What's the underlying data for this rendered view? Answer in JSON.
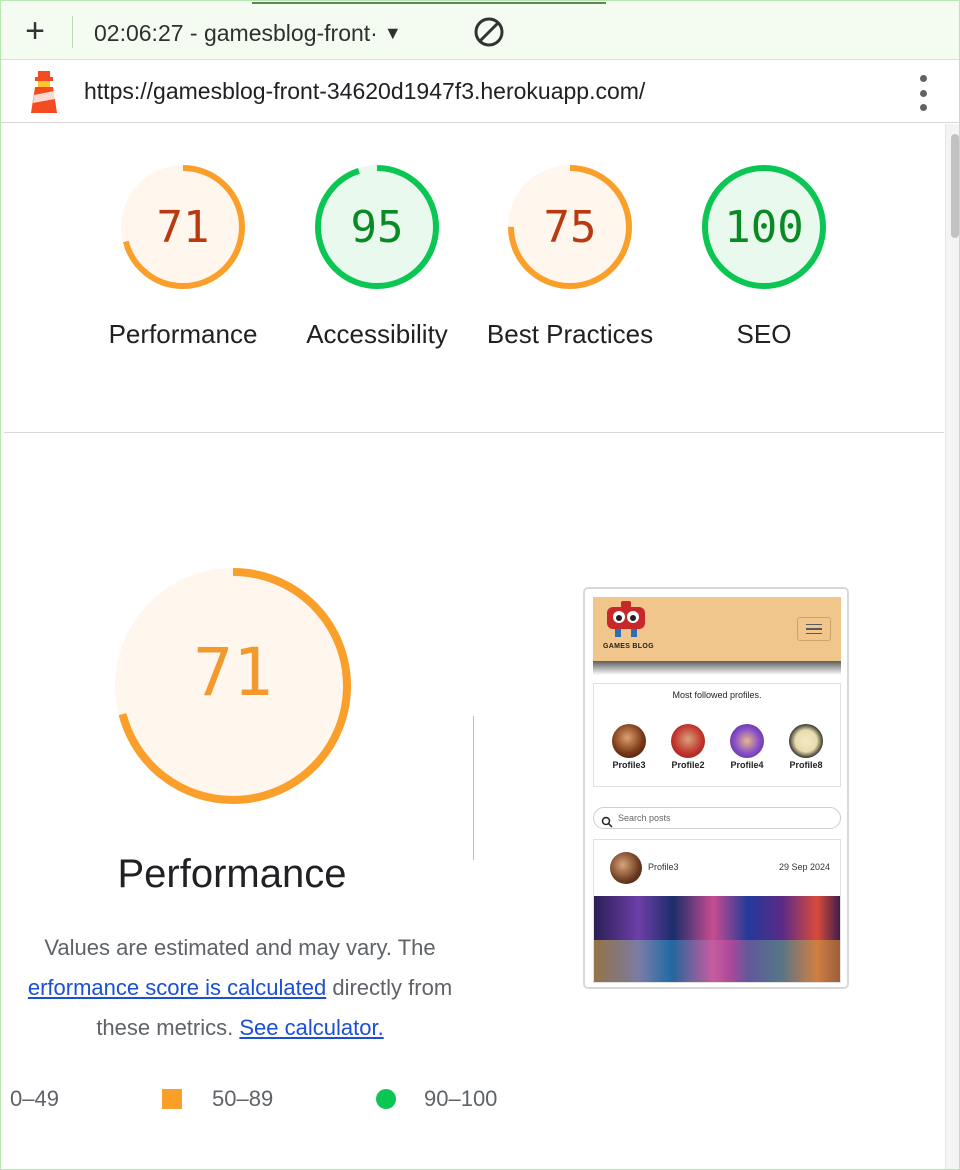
{
  "toolbar": {
    "add_label": "+",
    "report_selector": "02:06:27 - gamesblog-front·"
  },
  "urlbar": {
    "url": "https://gamesblog-front-34620d1947f3.herokuapp.com/"
  },
  "colors": {
    "average": "#fa9f2a",
    "average_text": "#b83a0e",
    "pass": "#0cc654",
    "pass_text": "#0a8a24"
  },
  "summary_gauges": [
    {
      "score": 71,
      "label": "Performance",
      "rating": "average"
    },
    {
      "score": 95,
      "label": "Accessibility",
      "rating": "pass"
    },
    {
      "score": 75,
      "label": "Best Practices",
      "rating": "average"
    },
    {
      "score": 100,
      "label": "SEO",
      "rating": "pass"
    }
  ],
  "performance": {
    "score": 71,
    "title": "Performance",
    "desc_text1": "Values are estimated and may vary. The",
    "desc_link1": "erformance score is calculated",
    "desc_text2": "directly from",
    "desc_text3": "these metrics.",
    "desc_link2": "See calculator."
  },
  "legend": {
    "fail": "0–49",
    "average": "50–89",
    "pass": "90–100"
  },
  "thumbnail": {
    "logo_text": "GAMES BLOG",
    "profiles_title": "Most followed profiles.",
    "profiles": [
      "Profile3",
      "Profile2",
      "Profile4",
      "Profile8"
    ],
    "search_placeholder": "Search posts",
    "post_author": "Profile3",
    "post_date": "29 Sep 2024"
  }
}
